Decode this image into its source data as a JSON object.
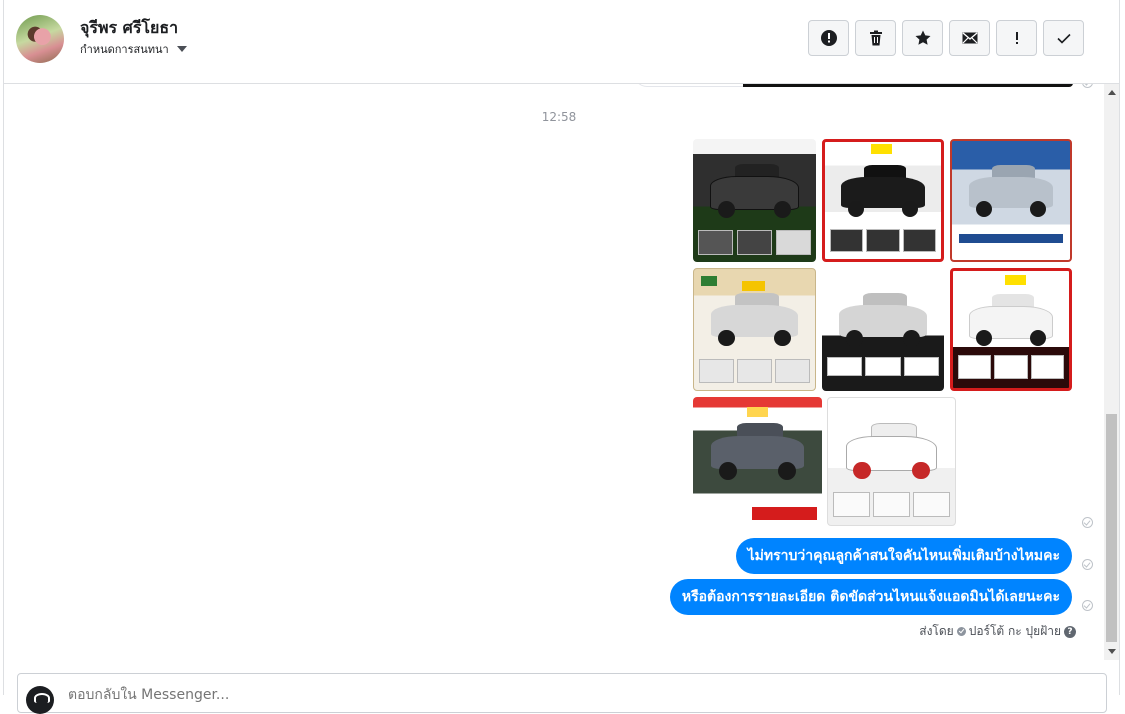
{
  "header": {
    "name": "จุรีพร ศรีโยธา",
    "subtitle": "กำหนดการสนทนา",
    "actions": [
      {
        "name": "spam-button",
        "icon": "alert-circle-icon"
      },
      {
        "name": "delete-button",
        "icon": "trash-icon"
      },
      {
        "name": "star-button",
        "icon": "star-icon"
      },
      {
        "name": "mark-unread-button",
        "icon": "envelope-icon"
      },
      {
        "name": "important-button",
        "icon": "exclamation-icon"
      },
      {
        "name": "done-button",
        "icon": "check-icon"
      }
    ]
  },
  "conversation": {
    "timestamp": "12:58",
    "photos": [
      {
        "name": "photo-mazda-bt50",
        "theme": "dark"
      },
      {
        "name": "photo-isuzu-dmax-black",
        "theme": "red"
      },
      {
        "name": "photo-toyota-vigo-silver",
        "theme": "blue"
      },
      {
        "name": "photo-toyota-vigo-champ",
        "theme": "beige"
      },
      {
        "name": "photo-isuzu-dmax-silver",
        "theme": "grey"
      },
      {
        "name": "photo-toyota-vigo-white",
        "theme": "red"
      },
      {
        "name": "photo-chevrolet-colorado-grey",
        "theme": "red"
      },
      {
        "name": "photo-chevrolet-colorado-white",
        "theme": "white"
      }
    ],
    "messages": [
      {
        "text": "ไม่ทราบว่าคุณลูกค้าสนใจคันไหนเพิ่มเติมบ้างไหมคะ"
      },
      {
        "text": "หรือต้องการรายละเอียด ติดขัดส่วนไหนแจ้งแอดมินได้เลยนะคะ"
      }
    ],
    "sent_by_label": "ส่งโดย",
    "sent_by_name": "ปอร์โต้ กะ ปุยฝ้าย",
    "help_glyph": "?"
  },
  "composer": {
    "placeholder": "ตอบกลับใน Messenger..."
  },
  "colors": {
    "accent": "#0084ff",
    "border": "#dddfe2"
  }
}
